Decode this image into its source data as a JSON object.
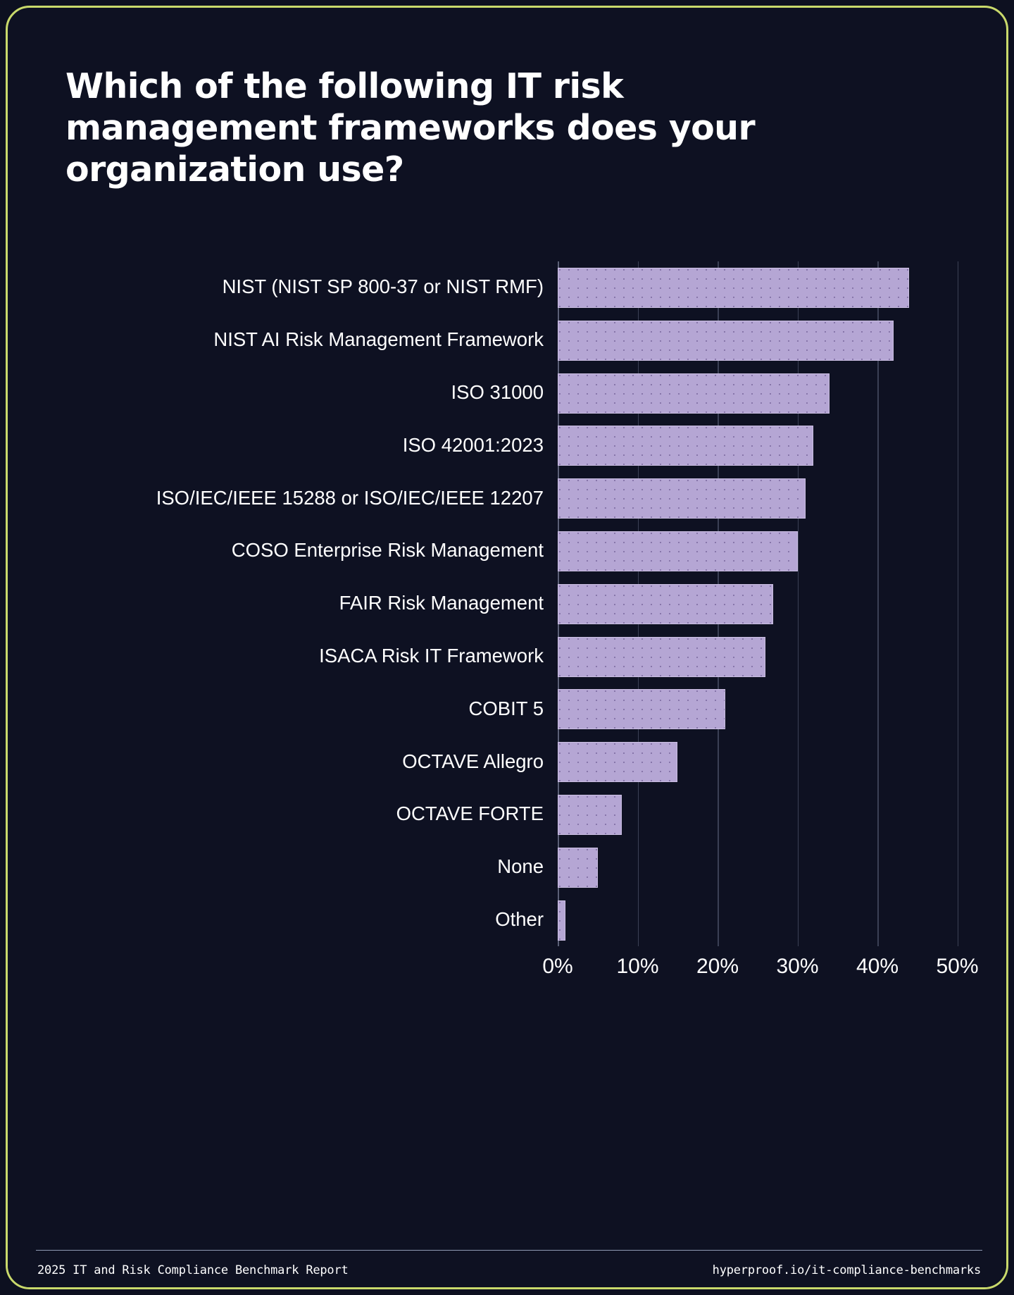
{
  "card": {
    "border_color": "#c9d96b",
    "background": "#0e1122"
  },
  "title": "Which of the following IT risk management frameworks does your organization use?",
  "footer": {
    "left": "2025 IT and Risk Compliance Benchmark Report",
    "right": "hyperproof.io/it-compliance-benchmarks"
  },
  "chart_data": {
    "type": "bar",
    "orientation": "horizontal",
    "title": "Which of the following IT risk management frameworks does your organization use?",
    "xlabel": "",
    "ylabel": "",
    "xlim": [
      0,
      50
    ],
    "tick_labels": [
      "0%",
      "10%",
      "20%",
      "30%",
      "40%",
      "50%"
    ],
    "ticks": [
      0,
      10,
      20,
      30,
      40,
      50
    ],
    "grid": true,
    "legend": "none",
    "bar_color": "#b5a6d4",
    "categories": [
      "NIST (NIST SP 800-37 or NIST RMF)",
      "NIST AI Risk Management Framework",
      "ISO 31000",
      "ISO 42001:2023",
      "ISO/IEC/IEEE 15288 or ISO/IEC/IEEE 12207",
      "COSO Enterprise Risk Management",
      "FAIR Risk Management",
      "ISACA Risk IT Framework",
      "COBIT 5",
      "OCTAVE Allegro",
      "OCTAVE FORTE",
      "None",
      "Other"
    ],
    "values": [
      44,
      42,
      34,
      32,
      31,
      30,
      27,
      26,
      21,
      15,
      8,
      5,
      1
    ]
  }
}
